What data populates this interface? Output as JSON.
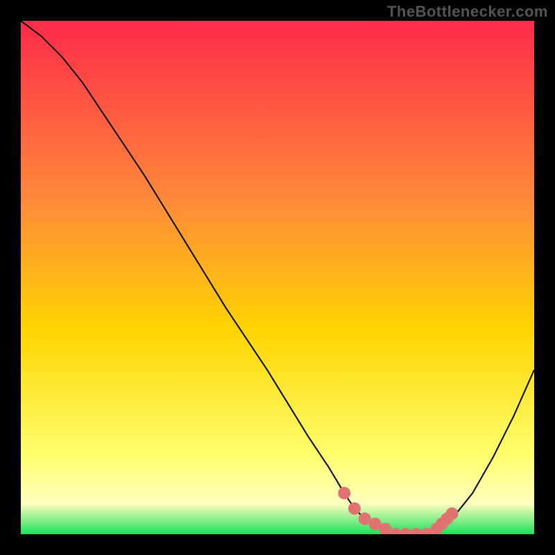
{
  "watermark": "TheBottlenecker.com",
  "chart_data": {
    "type": "line",
    "title": "",
    "xlabel": "",
    "ylabel": "",
    "xlim": [
      0,
      100
    ],
    "ylim": [
      0,
      100
    ],
    "gradient": {
      "top_color": "#ff2a4a",
      "mid_color": "#ffd400",
      "bottom_color_light": "#ffffc0",
      "bottom_color_green": "#1fe05a"
    },
    "series": [
      {
        "name": "bottleneck-curve",
        "color": "#000000",
        "stroke_width": 2,
        "x": [
          0,
          4,
          8,
          12,
          16,
          24,
          32,
          40,
          48,
          56,
          60,
          63,
          65,
          67,
          70,
          74,
          78,
          82,
          84,
          88,
          92,
          96,
          100
        ],
        "y": [
          100,
          97,
          93,
          88,
          82,
          70,
          57,
          44,
          32,
          19,
          13,
          8,
          5,
          3,
          1,
          0,
          0,
          1,
          3,
          8,
          15,
          23,
          32
        ]
      },
      {
        "name": "sweet-spot-markers",
        "color": "#e0736f",
        "type": "scatter",
        "marker_size": 9,
        "x": [
          63,
          65,
          67,
          69,
          71,
          73,
          75,
          77,
          79,
          81,
          82,
          83,
          84
        ],
        "y": [
          8,
          5,
          3,
          2,
          1,
          0,
          0,
          0,
          0,
          1,
          2,
          3,
          4
        ]
      }
    ]
  }
}
